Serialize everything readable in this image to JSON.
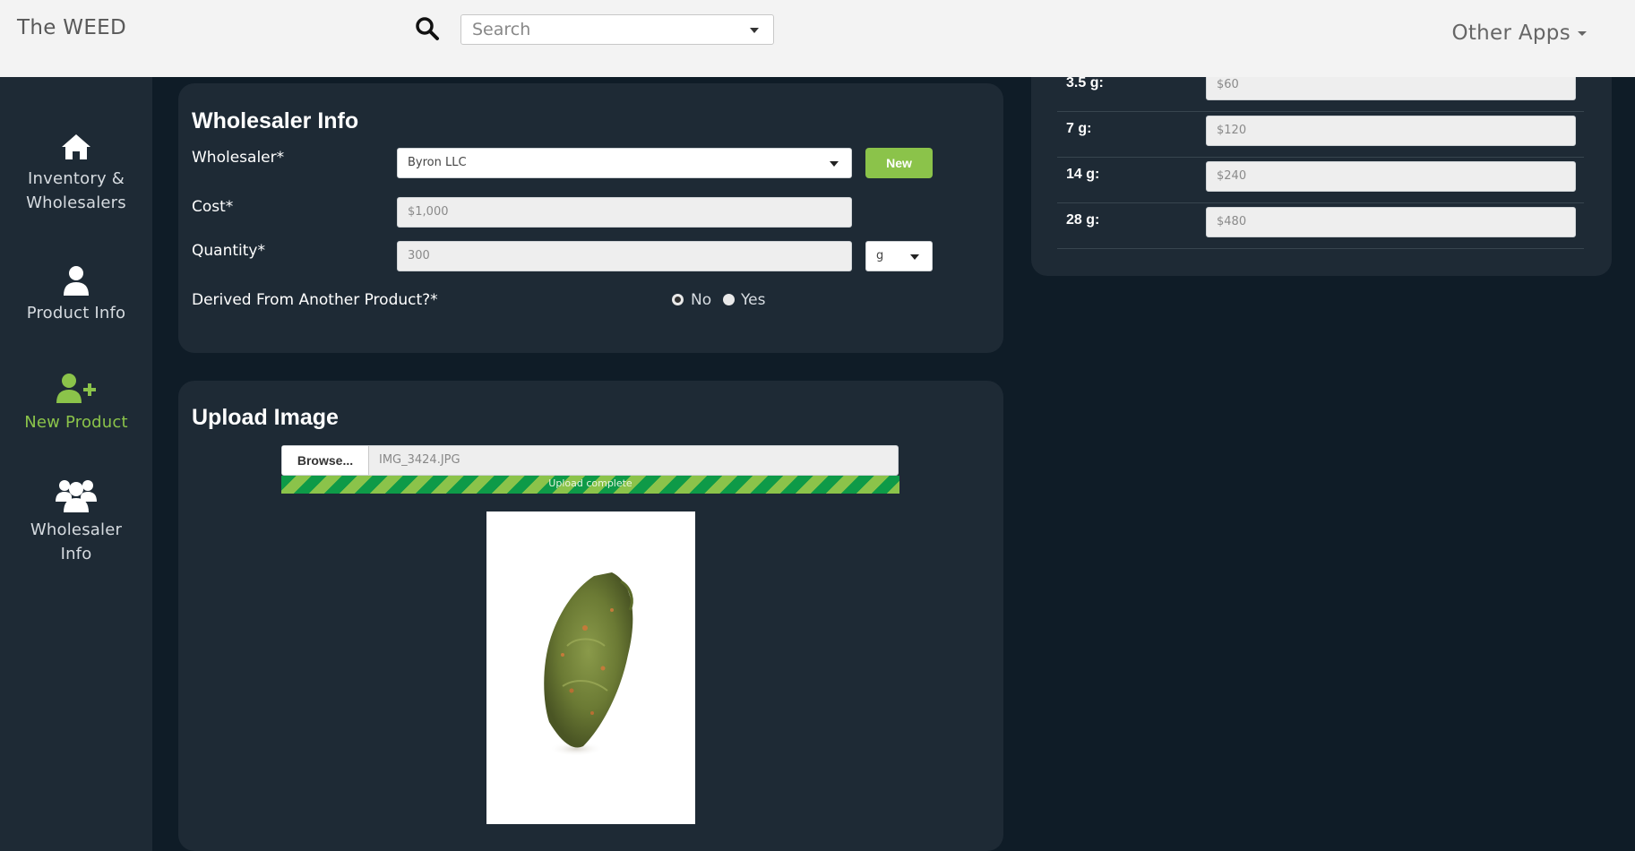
{
  "app": {
    "brand": "The WEED",
    "other_apps": "Other Apps"
  },
  "search": {
    "placeholder": "Search"
  },
  "sidebar": {
    "items": [
      {
        "label": "Inventory & Wholesalers",
        "icon": "home-icon"
      },
      {
        "label": "Product Info",
        "icon": "user-icon"
      },
      {
        "label": "New Product",
        "icon": "user-plus-icon",
        "active": true
      },
      {
        "label": "Wholesaler Info",
        "icon": "users-icon"
      }
    ]
  },
  "wholesaler_info": {
    "title": "Wholesaler Info",
    "wholesaler_label": "Wholesaler*",
    "wholesaler_value": "Byron LLC",
    "new_button": "New",
    "cost_label": "Cost*",
    "cost_value": "$1,000",
    "quantity_label": "Quantity*",
    "quantity_value": "300",
    "unit_value": "g",
    "derived_label": "Derived From Another Product?*",
    "derived_options": [
      "No",
      "Yes"
    ],
    "derived_selected": "No"
  },
  "upload": {
    "title": "Upload Image",
    "browse_label": "Browse...",
    "file_name": "IMG_3424.JPG",
    "progress_text": "Upload complete",
    "progress": 1.0
  },
  "pricing": {
    "rows": [
      {
        "label": "3.5 g:",
        "value": "$60"
      },
      {
        "label": "7 g:",
        "value": "$120"
      },
      {
        "label": "14 g:",
        "value": "$240"
      },
      {
        "label": "28 g:",
        "value": "$480"
      }
    ]
  },
  "colors": {
    "accent": "#8bc34a",
    "background": "#0f1c27",
    "panel": "#1e2a35",
    "topbar": "#f3f3f3"
  }
}
